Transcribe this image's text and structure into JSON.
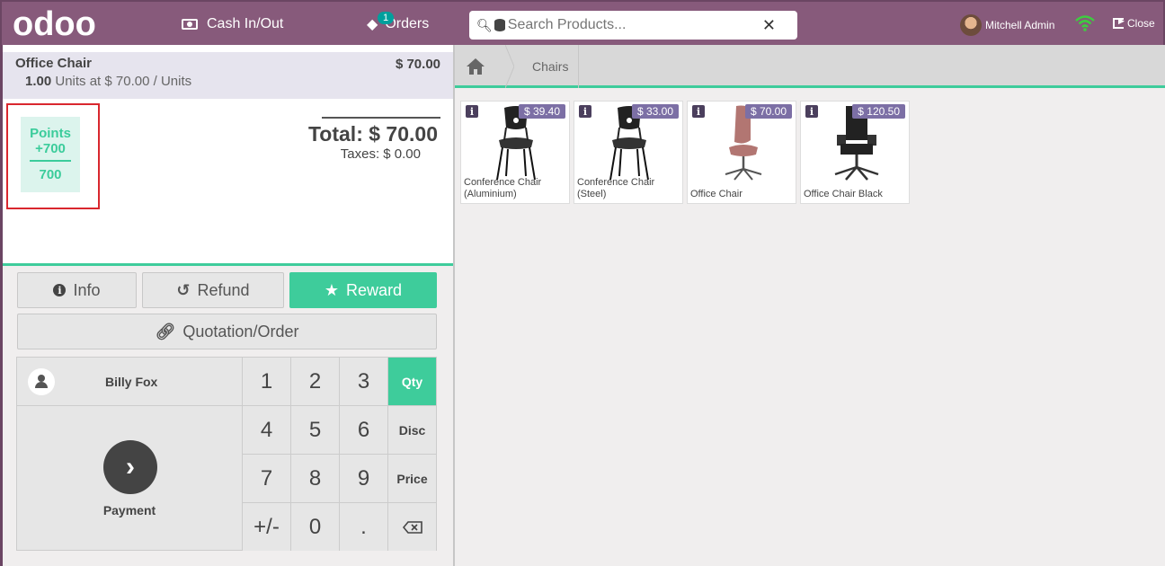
{
  "header": {
    "logo": "odoo",
    "cash_label": "Cash In/Out",
    "orders_label": "Orders",
    "orders_count": "1",
    "search_placeholder": "Search Products...",
    "user_name": "Mitchell Admin",
    "close_label": "Close"
  },
  "order": {
    "lines": [
      {
        "product": "Office Chair",
        "price": "$ 70.00",
        "qty": "1.00",
        "unit_text": "Units at $ 70.00 / Units"
      }
    ],
    "points_label": "Points",
    "points_won": "+700",
    "points_total": "700",
    "total": "Total: $ 70.00",
    "taxes": "Taxes: $ 0.00"
  },
  "controls": {
    "info": "Info",
    "refund": "Refund",
    "reward": "Reward",
    "quotation": "Quotation/Order"
  },
  "numpad": {
    "customer": "Billy Fox",
    "payment": "Payment",
    "keys": [
      "1",
      "2",
      "3",
      "4",
      "5",
      "6",
      "7",
      "8",
      "9",
      "+/-",
      "0",
      "."
    ],
    "modes": [
      "Qty",
      "Disc",
      "Price"
    ],
    "active_mode": "Qty"
  },
  "breadcrumb": {
    "category": "Chairs"
  },
  "products": [
    {
      "name": "Conference Chair (Aluminium)",
      "price": "$ 39.40"
    },
    {
      "name": "Conference Chair (Steel)",
      "price": "$ 33.00"
    },
    {
      "name": "Office Chair",
      "price": "$ 70.00"
    },
    {
      "name": "Office Chair Black",
      "price": "$ 120.50"
    }
  ],
  "colors": {
    "brand": "#875a7b",
    "accent": "#3ecc9b",
    "highlight": "#d9272e"
  }
}
